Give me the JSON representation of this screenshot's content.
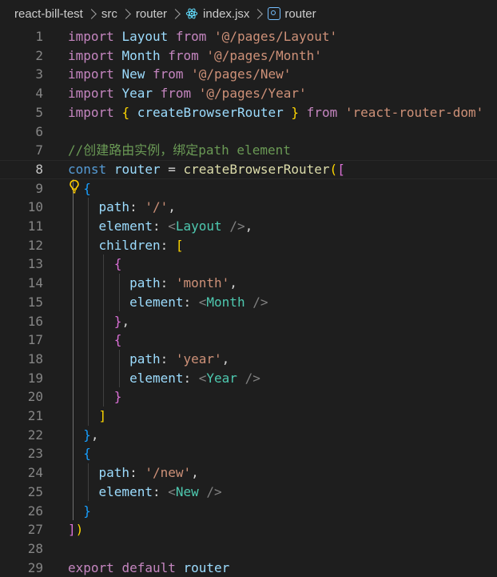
{
  "breadcrumb": {
    "items": [
      {
        "label": "react-bill-test",
        "icon": ""
      },
      {
        "label": "src",
        "icon": ""
      },
      {
        "label": "router",
        "icon": ""
      },
      {
        "label": "index.jsx",
        "icon": "react-icon"
      },
      {
        "label": "router",
        "icon": "symbol-variable-icon"
      }
    ]
  },
  "editor": {
    "current_line": 8,
    "lines": [
      {
        "n": "1",
        "tokens": [
          [
            "kw",
            "import"
          ],
          [
            "pn",
            " "
          ],
          [
            "id",
            "Layout"
          ],
          [
            "pn",
            " "
          ],
          [
            "kw",
            "from"
          ],
          [
            "pn",
            " "
          ],
          [
            "st",
            "'@/pages/Layout'"
          ]
        ]
      },
      {
        "n": "2",
        "tokens": [
          [
            "kw",
            "import"
          ],
          [
            "pn",
            " "
          ],
          [
            "id",
            "Month"
          ],
          [
            "pn",
            " "
          ],
          [
            "kw",
            "from"
          ],
          [
            "pn",
            " "
          ],
          [
            "st",
            "'@/pages/Month'"
          ]
        ]
      },
      {
        "n": "3",
        "tokens": [
          [
            "kw",
            "import"
          ],
          [
            "pn",
            " "
          ],
          [
            "id",
            "New"
          ],
          [
            "pn",
            " "
          ],
          [
            "kw",
            "from"
          ],
          [
            "pn",
            " "
          ],
          [
            "st",
            "'@/pages/New'"
          ]
        ]
      },
      {
        "n": "4",
        "tokens": [
          [
            "kw",
            "import"
          ],
          [
            "pn",
            " "
          ],
          [
            "id",
            "Year"
          ],
          [
            "pn",
            " "
          ],
          [
            "kw",
            "from"
          ],
          [
            "pn",
            " "
          ],
          [
            "st",
            "'@/pages/Year'"
          ]
        ]
      },
      {
        "n": "5",
        "tokens": [
          [
            "kw",
            "import"
          ],
          [
            "pn",
            " "
          ],
          [
            "b1",
            "{"
          ],
          [
            "pn",
            " "
          ],
          [
            "id",
            "createBrowserRouter"
          ],
          [
            "pn",
            " "
          ],
          [
            "b1",
            "}"
          ],
          [
            "pn",
            " "
          ],
          [
            "kw",
            "from"
          ],
          [
            "pn",
            " "
          ],
          [
            "st",
            "'react-router-dom'"
          ]
        ]
      },
      {
        "n": "6",
        "tokens": []
      },
      {
        "n": "7",
        "tokens": [
          [
            "cm",
            "//创建路由实例，绑定path element"
          ]
        ]
      },
      {
        "n": "8",
        "tokens": [
          [
            "kb",
            "const"
          ],
          [
            "pn",
            " "
          ],
          [
            "id",
            "router"
          ],
          [
            "pn",
            " = "
          ],
          [
            "fn",
            "createBrowserRouter"
          ],
          [
            "b1",
            "("
          ],
          [
            "b2",
            "["
          ]
        ]
      },
      {
        "n": "9",
        "tokens": [
          [
            "pn",
            "  "
          ],
          [
            "b3",
            "{"
          ]
        ]
      },
      {
        "n": "10",
        "tokens": [
          [
            "pn",
            "    "
          ],
          [
            "id",
            "path"
          ],
          [
            "pn",
            ": "
          ],
          [
            "st",
            "'/'"
          ],
          [
            "pn",
            ","
          ]
        ]
      },
      {
        "n": "11",
        "tokens": [
          [
            "pn",
            "    "
          ],
          [
            "id",
            "element"
          ],
          [
            "pn",
            ": "
          ],
          [
            "gy",
            "<"
          ],
          [
            "tg",
            "Layout"
          ],
          [
            "pn",
            " "
          ],
          [
            "gy",
            "/>"
          ],
          [
            "pn",
            ","
          ]
        ]
      },
      {
        "n": "12",
        "tokens": [
          [
            "pn",
            "    "
          ],
          [
            "id",
            "children"
          ],
          [
            "pn",
            ": "
          ],
          [
            "b1",
            "["
          ]
        ]
      },
      {
        "n": "13",
        "tokens": [
          [
            "pn",
            "      "
          ],
          [
            "b2",
            "{"
          ]
        ]
      },
      {
        "n": "14",
        "tokens": [
          [
            "pn",
            "        "
          ],
          [
            "id",
            "path"
          ],
          [
            "pn",
            ": "
          ],
          [
            "st",
            "'month'"
          ],
          [
            "pn",
            ","
          ]
        ]
      },
      {
        "n": "15",
        "tokens": [
          [
            "pn",
            "        "
          ],
          [
            "id",
            "element"
          ],
          [
            "pn",
            ": "
          ],
          [
            "gy",
            "<"
          ],
          [
            "tg",
            "Month"
          ],
          [
            "pn",
            " "
          ],
          [
            "gy",
            "/>"
          ]
        ]
      },
      {
        "n": "16",
        "tokens": [
          [
            "pn",
            "      "
          ],
          [
            "b2",
            "}"
          ],
          [
            "pn",
            ","
          ]
        ]
      },
      {
        "n": "17",
        "tokens": [
          [
            "pn",
            "      "
          ],
          [
            "b2",
            "{"
          ]
        ]
      },
      {
        "n": "18",
        "tokens": [
          [
            "pn",
            "        "
          ],
          [
            "id",
            "path"
          ],
          [
            "pn",
            ": "
          ],
          [
            "st",
            "'year'"
          ],
          [
            "pn",
            ","
          ]
        ]
      },
      {
        "n": "19",
        "tokens": [
          [
            "pn",
            "        "
          ],
          [
            "id",
            "element"
          ],
          [
            "pn",
            ": "
          ],
          [
            "gy",
            "<"
          ],
          [
            "tg",
            "Year"
          ],
          [
            "pn",
            " "
          ],
          [
            "gy",
            "/>"
          ]
        ]
      },
      {
        "n": "20",
        "tokens": [
          [
            "pn",
            "      "
          ],
          [
            "b2",
            "}"
          ]
        ]
      },
      {
        "n": "21",
        "tokens": [
          [
            "pn",
            "    "
          ],
          [
            "b1",
            "]"
          ]
        ]
      },
      {
        "n": "22",
        "tokens": [
          [
            "pn",
            "  "
          ],
          [
            "b3",
            "}"
          ],
          [
            "pn",
            ","
          ]
        ]
      },
      {
        "n": "23",
        "tokens": [
          [
            "pn",
            "  "
          ],
          [
            "b3",
            "{"
          ]
        ]
      },
      {
        "n": "24",
        "tokens": [
          [
            "pn",
            "    "
          ],
          [
            "id",
            "path"
          ],
          [
            "pn",
            ": "
          ],
          [
            "st",
            "'/new'"
          ],
          [
            "pn",
            ","
          ]
        ]
      },
      {
        "n": "25",
        "tokens": [
          [
            "pn",
            "    "
          ],
          [
            "id",
            "element"
          ],
          [
            "pn",
            ": "
          ],
          [
            "gy",
            "<"
          ],
          [
            "tg",
            "New"
          ],
          [
            "pn",
            " "
          ],
          [
            "gy",
            "/>"
          ]
        ]
      },
      {
        "n": "26",
        "tokens": [
          [
            "pn",
            "  "
          ],
          [
            "b3",
            "}"
          ]
        ]
      },
      {
        "n": "27",
        "tokens": [
          [
            "b2",
            "]"
          ],
          [
            "b1",
            ")"
          ]
        ]
      },
      {
        "n": "28",
        "tokens": []
      },
      {
        "n": "29",
        "tokens": [
          [
            "kw",
            "export"
          ],
          [
            "pn",
            " "
          ],
          [
            "kw",
            "default"
          ],
          [
            "pn",
            " "
          ],
          [
            "id",
            "router"
          ]
        ]
      }
    ]
  },
  "colors": {
    "background": "#1e1e1e",
    "keyword": "#c586c0",
    "storage": "#569cd6",
    "identifier": "#9cdcfe",
    "function": "#dcdcaa",
    "string": "#ce9178",
    "comment": "#6a9955",
    "tag": "#4ec9b0"
  }
}
